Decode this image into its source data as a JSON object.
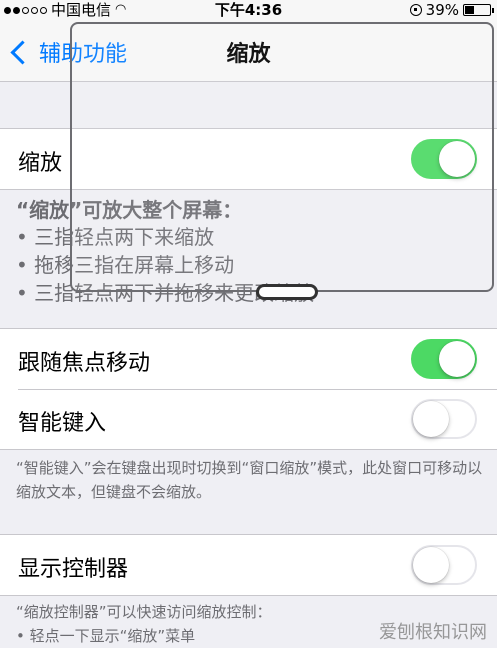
{
  "status_bar": {
    "carrier": "中国电信",
    "wifi": "Wi-Fi",
    "time": "下午4:36",
    "battery_pct": "39%",
    "battery_level": 0.39
  },
  "nav": {
    "back_label": "辅助功能",
    "title": "缩放"
  },
  "zoom_group": {
    "label": "缩放",
    "toggle_on": true
  },
  "zoom_footer": {
    "title": "“缩放”可放大整个屏幕：",
    "items": [
      "• 三指轻点两下来缩放",
      "• 拖移三指在屏幕上移动",
      "• 三指轻点两下并拖移来更改缩放"
    ]
  },
  "follow_group": {
    "follow_label": "跟随焦点移动",
    "follow_on": true,
    "smart_label": "智能键入",
    "smart_on": false
  },
  "smart_footer": {
    "text": "“智能键入”会在键盘出现时切换到“窗口缩放”模式，此处窗口可移动以缩放文本，但键盘不会缩放。"
  },
  "controller_group": {
    "label": "显示控制器",
    "toggle_on": false
  },
  "controller_footer": {
    "text": "“缩放控制器”可以快速访问缩放控制：",
    "items": [
      "• 轻点一下显示“缩放”菜单"
    ]
  },
  "watermark": "爱刨根知识网"
}
